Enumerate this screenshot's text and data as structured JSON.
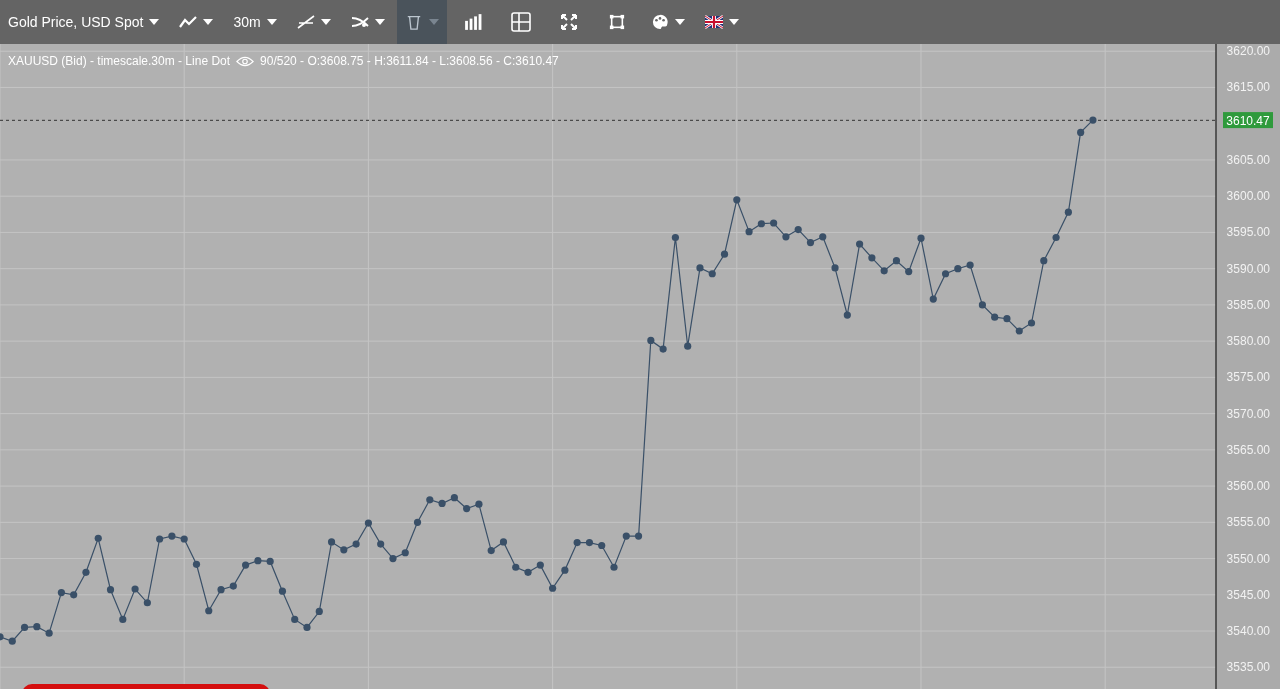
{
  "toolbar": {
    "tools": [
      {
        "kind": "text",
        "label": "Gold Price, USD Spot",
        "dropdown": true,
        "selected": false
      },
      {
        "kind": "line-chart",
        "dropdown": true,
        "selected": false
      },
      {
        "kind": "text",
        "label": "30m",
        "dropdown": true,
        "selected": false
      },
      {
        "kind": "trend-line",
        "dropdown": true,
        "selected": false
      },
      {
        "kind": "crossing",
        "dropdown": true,
        "selected": false
      },
      {
        "kind": "trash",
        "dropdown": true,
        "selected": true
      },
      {
        "kind": "bars",
        "dropdown": false,
        "selected": false
      },
      {
        "kind": "grid",
        "dropdown": false,
        "selected": false
      },
      {
        "kind": "fullscreen",
        "dropdown": false,
        "selected": false
      },
      {
        "kind": "frame",
        "dropdown": false,
        "selected": false
      },
      {
        "kind": "palette",
        "dropdown": true,
        "selected": false
      },
      {
        "kind": "flag",
        "dropdown": true,
        "selected": false
      }
    ]
  },
  "chart": {
    "info": "XAUUSD (Bid) - timescale.30m - Line Dot",
    "ohlc": "90/520 - O:3608.75 - H:3611.84 - L:3608.56 - C:3610.47",
    "price_label": "3610.47",
    "chart_data": {
      "type": "line",
      "ylim": [
        3532,
        3621
      ],
      "grid": true,
      "ref_lines": [
        {
          "axis": "y",
          "value": 3610.47
        }
      ],
      "yticks": [
        {
          "value": 3535,
          "label": "3535.00"
        },
        {
          "value": 3540,
          "label": "3540.00"
        },
        {
          "value": 3545,
          "label": "3545.00"
        },
        {
          "value": 3550,
          "label": "3550.00"
        },
        {
          "value": 3555,
          "label": "3555.00"
        },
        {
          "value": 3560,
          "label": "3560.00"
        },
        {
          "value": 3565,
          "label": "3565.00"
        },
        {
          "value": 3570,
          "label": "3570.00"
        },
        {
          "value": 3575,
          "label": "3575.00"
        },
        {
          "value": 3580,
          "label": "3580.00"
        },
        {
          "value": 3585,
          "label": "3585.00"
        },
        {
          "value": 3590,
          "label": "3590.00"
        },
        {
          "value": 3595,
          "label": "3595.00"
        },
        {
          "value": 3600,
          "label": "3600.00"
        },
        {
          "value": 3605,
          "label": "3605.00"
        },
        {
          "value": 3615,
          "label": "3615.00"
        },
        {
          "value": 3620,
          "label": "3620.00"
        }
      ],
      "series": [
        {
          "color": "#3a5068",
          "marker": "circle",
          "values": [
            3539.2,
            3538.6,
            3540.5,
            3540.6,
            3539.7,
            3545.3,
            3545.0,
            3548.1,
            3552.8,
            3545.7,
            3541.6,
            3545.8,
            3543.9,
            3552.7,
            3553.1,
            3552.7,
            3549.2,
            3542.8,
            3545.7,
            3546.2,
            3549.1,
            3549.7,
            3549.6,
            3545.5,
            3541.6,
            3540.5,
            3542.7,
            3552.3,
            3551.2,
            3552.0,
            3554.9,
            3552.0,
            3550.0,
            3550.8,
            3555.0,
            3558.1,
            3557.6,
            3558.4,
            3556.9,
            3557.5,
            3551.1,
            3552.3,
            3548.8,
            3548.1,
            3549.1,
            3545.9,
            3548.4,
            3552.2,
            3552.2,
            3551.8,
            3548.8,
            3553.1,
            3553.1,
            3580.1,
            3578.9,
            3594.3,
            3579.3,
            3590.1,
            3589.3,
            3592.0,
            3599.5,
            3595.1,
            3596.2,
            3596.3,
            3594.4,
            3595.4,
            3593.6,
            3594.4,
            3590.1,
            3583.6,
            3593.4,
            3591.5,
            3589.7,
            3591.1,
            3589.6,
            3594.2,
            3585.8,
            3589.3,
            3590.0,
            3590.5,
            3585.0,
            3583.3,
            3583.1,
            3581.4,
            3582.5,
            3591.1,
            3594.3,
            3597.8,
            3608.8,
            3610.5
          ]
        }
      ]
    }
  }
}
